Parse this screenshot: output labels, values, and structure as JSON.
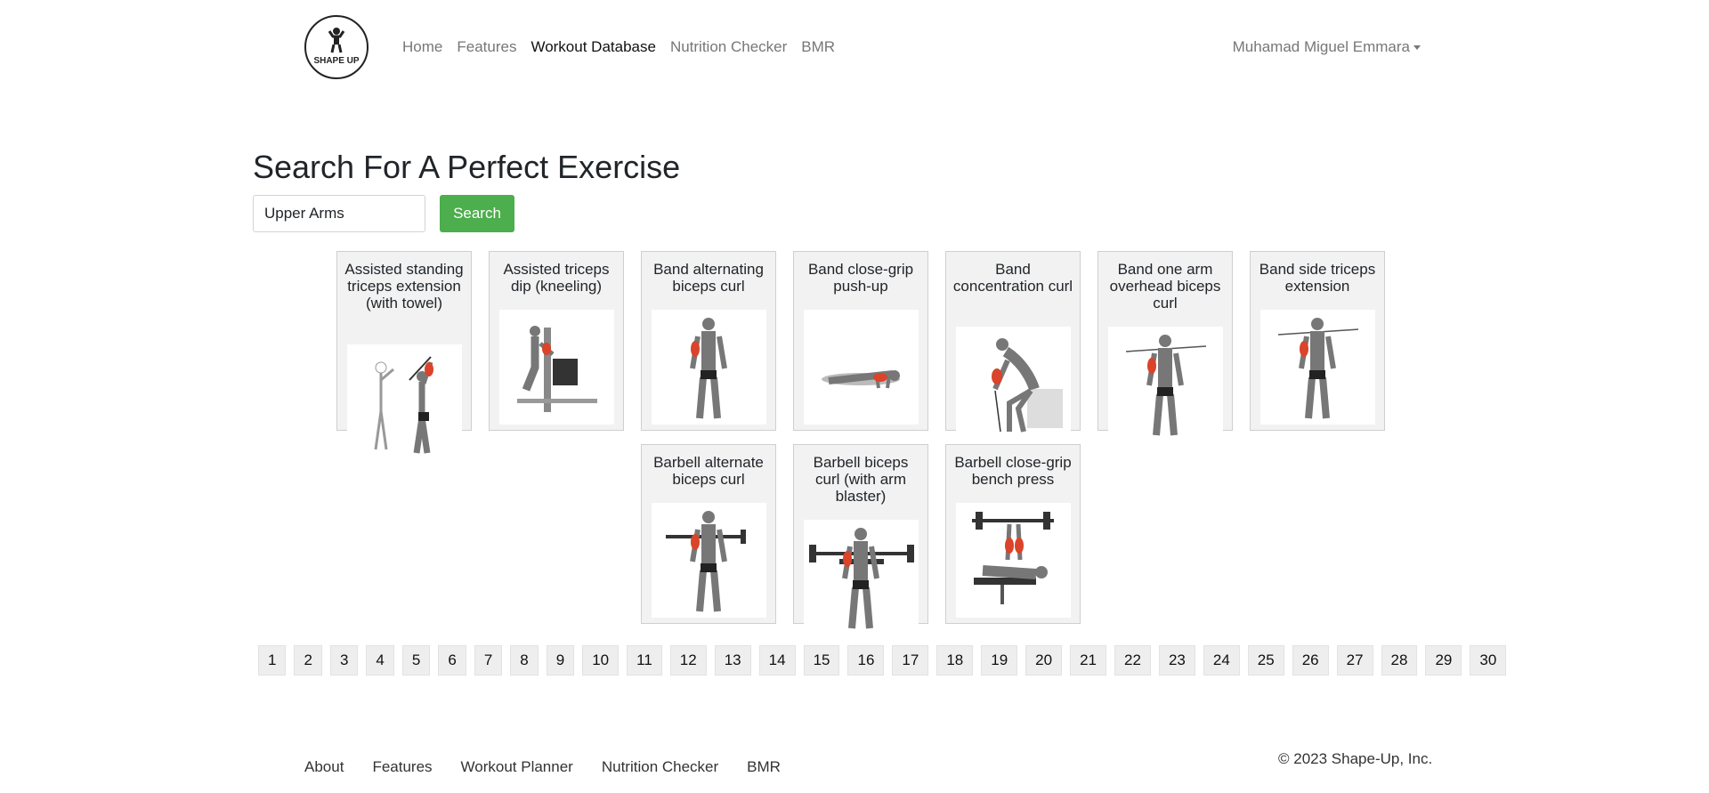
{
  "brand": {
    "logo_text": "SHAPE UP"
  },
  "nav": {
    "links": [
      "Home",
      "Features",
      "Workout Database",
      "Nutrition Checker",
      "BMR"
    ],
    "active_index": 2,
    "user_name": "Muhamad Miguel Emmara"
  },
  "search": {
    "title": "Search For A Perfect Exercise",
    "value": "Upper Arms",
    "button_label": "Search",
    "button_color": "#4cae4c"
  },
  "exercises": [
    "Assisted standing triceps extension (with towel)",
    "Assisted triceps dip (kneeling)",
    "Band alternating biceps curl",
    "Band close-grip push-up",
    "Band concentration curl",
    "Band one arm overhead biceps curl",
    "Band side triceps extension",
    "Barbell alternate biceps curl",
    "Barbell biceps curl (with arm blaster)",
    "Barbell close-grip bench press"
  ],
  "pagination": [
    "1",
    "2",
    "3",
    "4",
    "5",
    "6",
    "7",
    "8",
    "9",
    "10",
    "11",
    "12",
    "13",
    "14",
    "15",
    "16",
    "17",
    "18",
    "19",
    "20",
    "21",
    "22",
    "23",
    "24",
    "25",
    "26",
    "27",
    "28",
    "29",
    "30"
  ],
  "footer": {
    "links": [
      "About",
      "Features",
      "Workout Planner",
      "Nutrition Checker",
      "BMR"
    ],
    "copyright": "© 2023 Shape-Up, Inc."
  },
  "colors": {
    "muscle_highlight": "#d9442a",
    "card_bg": "#f2f2f2"
  }
}
